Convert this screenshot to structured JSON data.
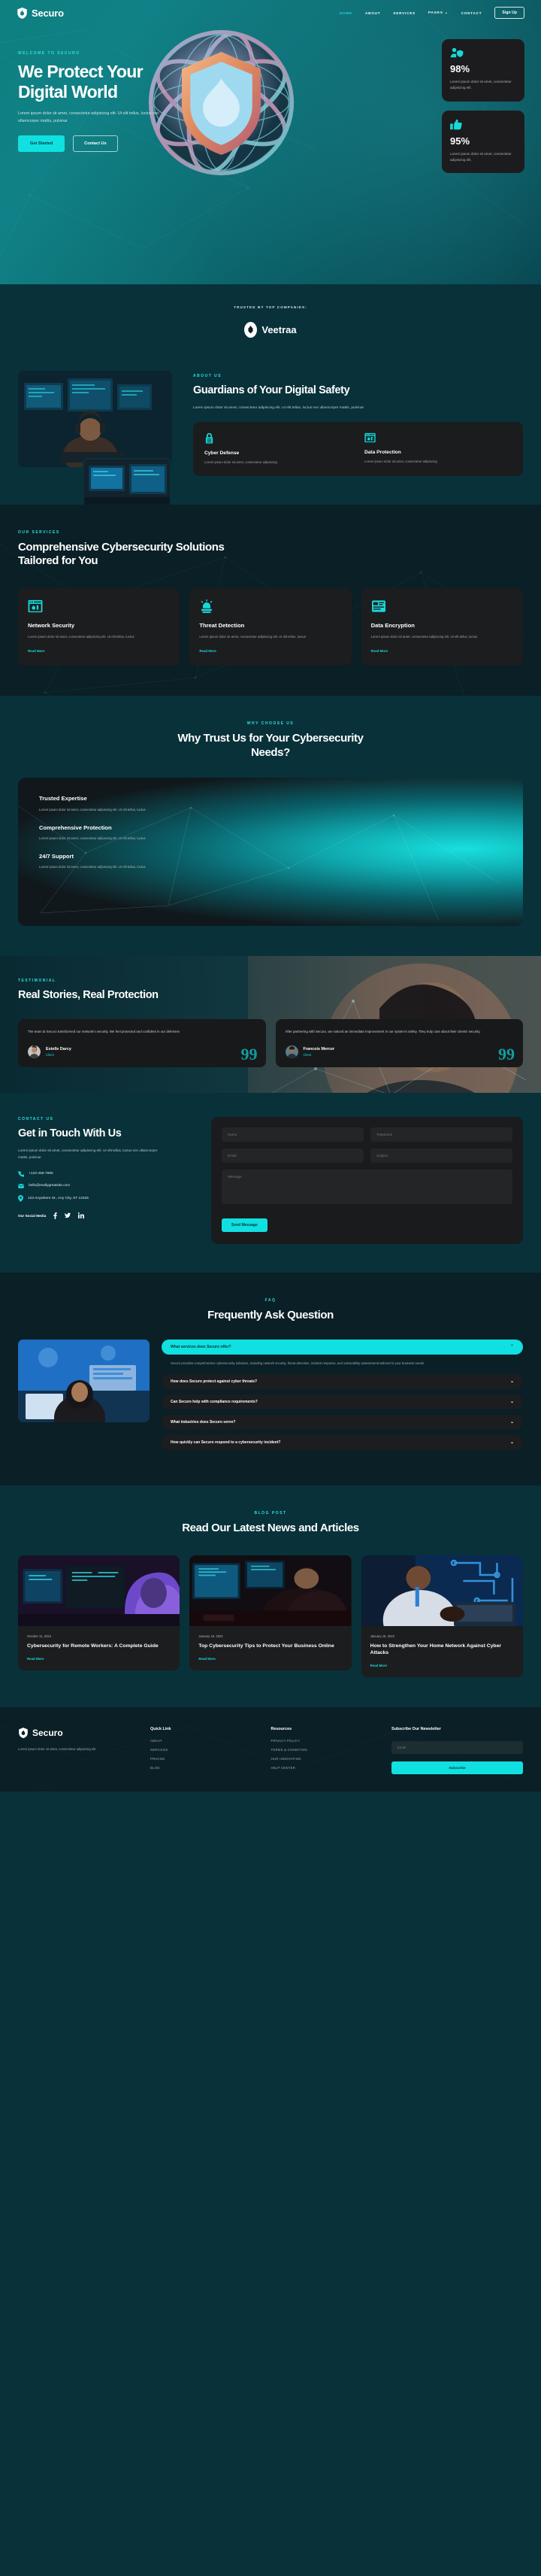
{
  "brand": {
    "name": "Securo",
    "icon": "shield-flame-icon"
  },
  "nav": {
    "links": [
      {
        "label": "HOME",
        "active": true
      },
      {
        "label": "ABOUT",
        "active": false
      },
      {
        "label": "SERVICES",
        "active": false
      },
      {
        "label": "PAGES",
        "active": false,
        "caret": "⌄"
      },
      {
        "label": "CONTACT",
        "active": false
      }
    ],
    "signup_label": "Sign Up"
  },
  "hero": {
    "eyebrow": "WELCOME TO SECURO",
    "title": "We Protect Your Digital World",
    "paragraph": "Lorem ipsum dolor sit amet, consectetur adipiscing elit. Ut elit tellus, luctus nec ullamcorper mattis, pulvinar",
    "primary_btn": "Get Started",
    "secondary_btn": "Contact Us",
    "stats": [
      {
        "icon": "user-shield-icon",
        "value": "98%",
        "text": "Lorem ipsum dolor sit amet, consectetur adipiscing elit."
      },
      {
        "icon": "thumbs-up-icon",
        "value": "95%",
        "text": "Lorem ipsum dolor sit amet, consectetur adipiscing elit."
      }
    ]
  },
  "trusted": {
    "label": "TRUSTED BY TOP COMPANIES:",
    "logo_name": "Veetraa"
  },
  "about": {
    "eyebrow": "ABOUT US",
    "title": "Guardians of Your Digital Safety",
    "paragraph": "Lorem ipsum dolor sit amet, consectetur adipiscing elit. Ut elit tellus, luctus nec ullamcorper mattis, pulvinar",
    "cards": [
      {
        "icon": "padlock-icon",
        "title": "Cyber Defense",
        "text": "Lorem ipsum dolor sit amet, consectetur adipiscing"
      },
      {
        "icon": "browser-shield-icon",
        "title": "Data Protection",
        "text": "Lorem ipsum dolor sit amet, consectetur adipiscing"
      }
    ]
  },
  "services": {
    "eyebrow": "OUR SERVICES",
    "title": "Comprehensive Cybersecurity Solutions Tailored for You",
    "read_more": "Read More",
    "cards": [
      {
        "icon": "browser-shield-icon",
        "title": "Network Security",
        "text": "Lorem ipsum dolor sit amet, consectetur adipiscing elit. Ut elit tellus, luctus"
      },
      {
        "icon": "alarm-siren-icon",
        "title": "Threat Detection",
        "text": "Lorem ipsum dolor sit amet, consectetur adipiscing elit. Ut elit tellus, luctus"
      },
      {
        "icon": "database-lock-icon",
        "title": "Data Encryption",
        "text": "Lorem ipsum dolor sit amet, consectetur adipiscing elit. Ut elit tellus, luctus"
      }
    ]
  },
  "why": {
    "eyebrow": "WHY CHOOSE US",
    "title": "Why Trust Us for Your Cybersecurity Needs?",
    "items": [
      {
        "title": "Trusted Expertise",
        "text": "Lorem ipsum dolor sit amet, consectetur adipiscing elit. Ut elit tellus, luctus"
      },
      {
        "title": "Comprehensive Protection",
        "text": "Lorem ipsum dolor sit amet, consectetur adipiscing elit. Ut elit tellus, luctus"
      },
      {
        "title": "24/7 Support",
        "text": "Lorem ipsum dolor sit amet, consectetur adipiscing elit. Ut elit tellus, luctus"
      }
    ]
  },
  "testimonials": {
    "eyebrow": "TESTIMONIAL",
    "title": "Real Stories, Real Protection",
    "quote_glyph": "99",
    "items": [
      {
        "quote": "The team at Securo transformed our network's security. We feel protected and confident in our defenses",
        "name": "Estelle Darcy",
        "role": "Client"
      },
      {
        "quote": "After partnering with Securo, we noticed an immediate improvement in our system's safety. They truly care about their clients' security.",
        "name": "Francois Mercer",
        "role": "Client"
      }
    ]
  },
  "contact": {
    "eyebrow": "CONTACT US",
    "title": "Get in Touch With Us",
    "paragraph": "Lorem ipsum dolor sit amet, consectetur adipiscing elit. Ut elit tellus, luctus nec ullamcorper mattis, pulvinar",
    "phone": "+123-456-7890",
    "email": "hello@reallygreatsite.com",
    "address": "123 Anywhere St., Any City, ST 12345",
    "social_label": "Our Social Media",
    "form": {
      "name_placeholder": "Name",
      "telephone_placeholder": "Telephone",
      "email_placeholder": "Email",
      "subject_placeholder": "Subject",
      "message_placeholder": "Message",
      "send_label": "Send Message"
    }
  },
  "faq": {
    "eyebrow": "FAQ",
    "title": "Frequently Ask Question",
    "items": [
      {
        "question": "What services does Securo offer?",
        "open": true,
        "chevron": "⌃",
        "answer": "Securo provides comprehensive cybersecurity solutions, including network security, threat detection, incident response, and vulnerability assessments tailored to your business needs."
      },
      {
        "question": "How does Securo protect against cyber threats?",
        "open": false,
        "chevron": "⌄",
        "answer": ""
      },
      {
        "question": "Can Securo help with compliance requirements?",
        "open": false,
        "chevron": "⌄",
        "answer": ""
      },
      {
        "question": "What industries does Securo serve?",
        "open": false,
        "chevron": "⌄",
        "answer": ""
      },
      {
        "question": "How quickly can Securo respond to a cybersecurity incident?",
        "open": false,
        "chevron": "⌄",
        "answer": ""
      }
    ]
  },
  "blog": {
    "eyebrow": "BLOG POST",
    "title": "Read Our Latest News and Articles",
    "read_more": "Read More",
    "posts": [
      {
        "date": "October 11, 2024",
        "title": "Cybersecurity for Remote Workers: A Complete Guide"
      },
      {
        "date": "January 16, 2022",
        "title": "Top Cybersecurity Tips to Protect Your Business Online"
      },
      {
        "date": "January 16, 2022",
        "title": "How to Strengthen Your Home Network Against Cyber Attacks"
      }
    ]
  },
  "footer": {
    "brand": "Securo",
    "about": "Lorem ipsum dolor sit amet, consectetur adipiscing elit",
    "quick_link": {
      "title": "Quick Link",
      "links": [
        "ABOUT",
        "SERVICES",
        "PRICING",
        "BLOG"
      ]
    },
    "resources": {
      "title": "Resources",
      "links": [
        "PRIVACY POLICY",
        "TERMS & CONDITION",
        "OUR INNOVATION",
        "HELP CENTER"
      ]
    },
    "newsletter": {
      "title": "Subscribe Our Newsletter",
      "placeholder": "Email",
      "button": "Subscribe"
    }
  },
  "colors": {
    "accent": "#11e0e0",
    "teal_dark": "#08313a",
    "panel": "#1c1d1f",
    "deep": "#0a1f26"
  }
}
